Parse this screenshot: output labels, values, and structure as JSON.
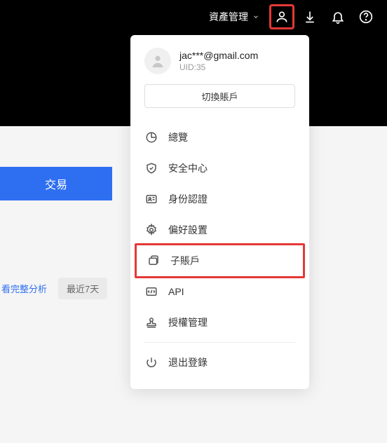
{
  "topbar": {
    "asset_mgmt": "資產管理"
  },
  "user": {
    "email": "jac***@gmail.com",
    "uid_label": "UID:35"
  },
  "switch_account": "切換賬戶",
  "menu": {
    "overview": "總覽",
    "security": "安全中心",
    "identity": "身份認證",
    "preferences": "偏好設置",
    "subaccount": "子賬戶",
    "api": "API",
    "auth_mgmt": "授權管理",
    "logout": "退出登錄"
  },
  "content": {
    "trade": "交易",
    "full_analysis": "看完整分析",
    "recent7": "最近7天"
  }
}
